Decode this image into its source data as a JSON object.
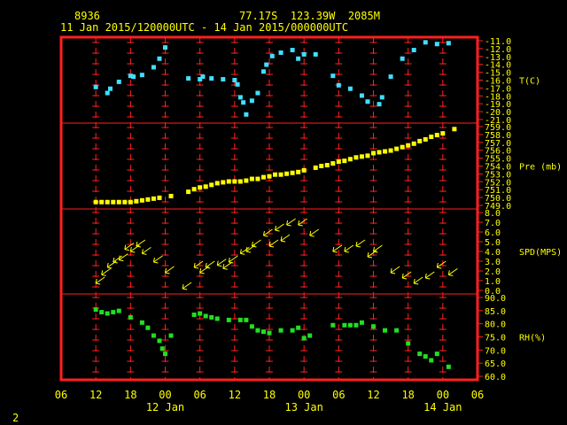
{
  "header": {
    "station": "8936",
    "location": "77.17S  123.39W  2085M",
    "period": "11 Jan 2015/120000UTC - 14 Jan 2015/000000UTC"
  },
  "footer_label": "2",
  "colors": {
    "frame": "#ff2020",
    "tick": "#ff2020",
    "text": "#ffff00",
    "temp": "#40e0ff",
    "pres": "#ffff00",
    "wind": "#ffff00",
    "rh": "#20e020"
  },
  "chart_data": {
    "type": "scatter",
    "x_axis": {
      "unit": "hours since 11 Jan 2015 00 UTC",
      "range": [
        6,
        78
      ],
      "tick_values": [
        6,
        12,
        18,
        24,
        30,
        36,
        42,
        48,
        54,
        60,
        66,
        72,
        78
      ],
      "tick_labels": [
        "06",
        "12",
        "18",
        "00",
        "06",
        "12",
        "18",
        "00",
        "06",
        "12",
        "18",
        "00",
        "06"
      ],
      "day_labels": [
        {
          "x": 24,
          "label": "12 Jan"
        },
        {
          "x": 48,
          "label": "13 Jan"
        },
        {
          "x": 72,
          "label": "14 Jan"
        }
      ]
    },
    "panels": [
      {
        "name": "temperature",
        "label": "T(C)",
        "ticks": [
          "-11.0",
          "-12.0",
          "-13.0",
          "-14.0",
          "-15.0",
          "-16.0",
          "-17.0",
          "-18.0",
          "-19.0",
          "-20.0",
          "-21.0"
        ],
        "ylim": [
          -21,
          -11
        ],
        "points": [
          [
            12,
            -16.8
          ],
          [
            14,
            -17.5
          ],
          [
            14.5,
            -17.0
          ],
          [
            16,
            -16.2
          ],
          [
            18,
            -15.5
          ],
          [
            18.5,
            -15.6
          ],
          [
            20,
            -15.4
          ],
          [
            22,
            -14.5
          ],
          [
            23,
            -13.5
          ],
          [
            24,
            -12.2
          ],
          [
            28,
            -15.8
          ],
          [
            30,
            -15.9
          ],
          [
            30.5,
            -15.6
          ],
          [
            32,
            -15.8
          ],
          [
            34,
            -15.9
          ],
          [
            36,
            -16.0
          ],
          [
            36.5,
            -16.5
          ],
          [
            37,
            -18.0
          ],
          [
            37.5,
            -18.6
          ],
          [
            38,
            -20.0
          ],
          [
            39,
            -18.4
          ],
          [
            40,
            -17.5
          ],
          [
            41,
            -15.0
          ],
          [
            41.5,
            -14.2
          ],
          [
            42.5,
            -13.2
          ],
          [
            44,
            -12.8
          ],
          [
            46,
            -12.5
          ],
          [
            47,
            -13.5
          ],
          [
            48,
            -13.0
          ],
          [
            50,
            -13.0
          ],
          [
            53,
            -15.5
          ],
          [
            54,
            -16.6
          ],
          [
            56,
            -17.0
          ],
          [
            58,
            -17.8
          ],
          [
            59,
            -18.5
          ],
          [
            61,
            -18.8
          ],
          [
            61.5,
            -18.0
          ],
          [
            63,
            -15.6
          ],
          [
            65,
            -13.5
          ],
          [
            67,
            -12.5
          ],
          [
            69,
            -11.6
          ],
          [
            71,
            -11.8
          ],
          [
            73,
            -11.7
          ]
        ]
      },
      {
        "name": "pressure",
        "label": "Pre (mb)",
        "ticks": [
          "759.0",
          "758.0",
          "757.0",
          "756.0",
          "755.0",
          "754.0",
          "753.0",
          "752.0",
          "751.0",
          "750.0",
          "749.0"
        ],
        "ylim": [
          749,
          759
        ],
        "points": [
          [
            12,
            749.8
          ],
          [
            13,
            749.8
          ],
          [
            14,
            749.8
          ],
          [
            15,
            749.8
          ],
          [
            16,
            749.8
          ],
          [
            17,
            749.8
          ],
          [
            18,
            749.8
          ],
          [
            19,
            749.9
          ],
          [
            20,
            750
          ],
          [
            21,
            750.1
          ],
          [
            22,
            750.2
          ],
          [
            23,
            750.3
          ],
          [
            25,
            750.5
          ],
          [
            28,
            751
          ],
          [
            29,
            751.3
          ],
          [
            30,
            751.5
          ],
          [
            31,
            751.6
          ],
          [
            32,
            751.8
          ],
          [
            33,
            752
          ],
          [
            34,
            752.1
          ],
          [
            35,
            752.2
          ],
          [
            36,
            752.2
          ],
          [
            37,
            752.2
          ],
          [
            38,
            752.3
          ],
          [
            39,
            752.5
          ],
          [
            40,
            752.5
          ],
          [
            41,
            752.7
          ],
          [
            42,
            752.8
          ],
          [
            43,
            753
          ],
          [
            44,
            753
          ],
          [
            45,
            753.1
          ],
          [
            46,
            753.2
          ],
          [
            47,
            753.3
          ],
          [
            48,
            753.5
          ],
          [
            50,
            753.8
          ],
          [
            51,
            754
          ],
          [
            52,
            754.1
          ],
          [
            53,
            754.3
          ],
          [
            54,
            754.5
          ],
          [
            55,
            754.6
          ],
          [
            56,
            754.8
          ],
          [
            57,
            755
          ],
          [
            58,
            755.1
          ],
          [
            59,
            755.2
          ],
          [
            60,
            755.5
          ],
          [
            61,
            755.6
          ],
          [
            62,
            755.7
          ],
          [
            63,
            755.8
          ],
          [
            64,
            756
          ],
          [
            65,
            756.2
          ],
          [
            66,
            756.4
          ],
          [
            67,
            756.6
          ],
          [
            68,
            756.9
          ],
          [
            69,
            757.1
          ],
          [
            70,
            757.4
          ],
          [
            71,
            757.6
          ],
          [
            72,
            757.8
          ],
          [
            74,
            758.3
          ]
        ]
      },
      {
        "name": "wind",
        "label": "SPD(MPS)",
        "ticks": [
          "8.0",
          "7.0",
          "6.0",
          "5.0",
          "4.0",
          "3.0",
          "2.0",
          "1.0",
          "0.0"
        ],
        "ylim": [
          0,
          8
        ],
        "points": [
          [
            12,
            1.0
          ],
          [
            13,
            1.8
          ],
          [
            14,
            2.5
          ],
          [
            15,
            3.0
          ],
          [
            16,
            3.2
          ],
          [
            17,
            4.2
          ],
          [
            18,
            4.0
          ],
          [
            19,
            4.5
          ],
          [
            20,
            3.8
          ],
          [
            22,
            3.0
          ],
          [
            24,
            2.0
          ],
          [
            27,
            0.5
          ],
          [
            29,
            2.5
          ],
          [
            30,
            2.0
          ],
          [
            31,
            2.5
          ],
          [
            33,
            2.7
          ],
          [
            34,
            2.4
          ],
          [
            35,
            3.0
          ],
          [
            37,
            3.8
          ],
          [
            38,
            4.0
          ],
          [
            39,
            4.5
          ],
          [
            41,
            5.5
          ],
          [
            42,
            4.5
          ],
          [
            43,
            6.0
          ],
          [
            44,
            5.0
          ],
          [
            45,
            6.5
          ],
          [
            47,
            6.5
          ],
          [
            49,
            5.5
          ],
          [
            53,
            4.0
          ],
          [
            55,
            4.0
          ],
          [
            57,
            4.5
          ],
          [
            59,
            3.5
          ],
          [
            60,
            4.0
          ],
          [
            63,
            2.0
          ],
          [
            65,
            1.5
          ],
          [
            67,
            1.0
          ],
          [
            69,
            1.5
          ],
          [
            71,
            2.5
          ],
          [
            73,
            1.8
          ]
        ]
      },
      {
        "name": "humidity",
        "label": "RH(%)",
        "ticks": [
          "90.0",
          "85.0",
          "80.0",
          "75.0",
          "70.0",
          "65.0",
          "60.0"
        ],
        "ylim": [
          60,
          93
        ],
        "points": [
          [
            12,
            87
          ],
          [
            13,
            86
          ],
          [
            14,
            85.5
          ],
          [
            15,
            86
          ],
          [
            16,
            86.5
          ],
          [
            18,
            84
          ],
          [
            20,
            82
          ],
          [
            21,
            80
          ],
          [
            22,
            77
          ],
          [
            23,
            75
          ],
          [
            23.5,
            72
          ],
          [
            24,
            70
          ],
          [
            25,
            77
          ],
          [
            29,
            85
          ],
          [
            30,
            85.5
          ],
          [
            31,
            84.5
          ],
          [
            32,
            84
          ],
          [
            33,
            83.5
          ],
          [
            35,
            83
          ],
          [
            37,
            83
          ],
          [
            38,
            83
          ],
          [
            39,
            80.5
          ],
          [
            40,
            79
          ],
          [
            41,
            78.5
          ],
          [
            42,
            78
          ],
          [
            44,
            79
          ],
          [
            46,
            79
          ],
          [
            47,
            80
          ],
          [
            48,
            76
          ],
          [
            49,
            77
          ],
          [
            53,
            81
          ],
          [
            55,
            81
          ],
          [
            56,
            81
          ],
          [
            57,
            81
          ],
          [
            58,
            82
          ],
          [
            60,
            80.5
          ],
          [
            62,
            79
          ],
          [
            64,
            79
          ],
          [
            66,
            74
          ],
          [
            68,
            70
          ],
          [
            69,
            69
          ],
          [
            70,
            67.5
          ],
          [
            71,
            70
          ],
          [
            73,
            65
          ]
        ]
      }
    ]
  }
}
